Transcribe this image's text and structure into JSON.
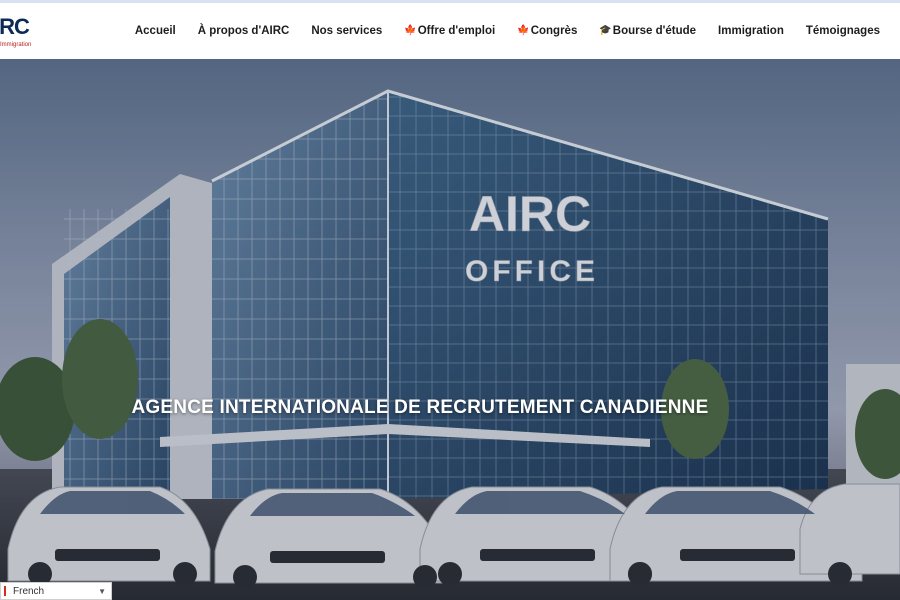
{
  "logo": {
    "main": "IRC",
    "sub": "Immigration"
  },
  "nav": {
    "items": [
      {
        "label": "Accueil",
        "icon": ""
      },
      {
        "label": "À propos d'AIRC",
        "icon": ""
      },
      {
        "label": "Nos services",
        "icon": ""
      },
      {
        "label": "Offre d'emploi",
        "icon": "🍁"
      },
      {
        "label": "Congrès",
        "icon": "🍁"
      },
      {
        "label": "Bourse d'étude",
        "icon": "🎓"
      },
      {
        "label": "Immigration",
        "icon": ""
      },
      {
        "label": "Témoignages",
        "icon": ""
      }
    ]
  },
  "hero": {
    "title": "AGENCE INTERNATIONALE DE RECRUTEMENT CANADIENNE",
    "sign_line1": "AIRC",
    "sign_line2": "OFFICE"
  },
  "language": {
    "selected": "French"
  },
  "colors": {
    "brand": "#0b2a55",
    "accent": "#b3261e",
    "maple": "#d9531e"
  }
}
